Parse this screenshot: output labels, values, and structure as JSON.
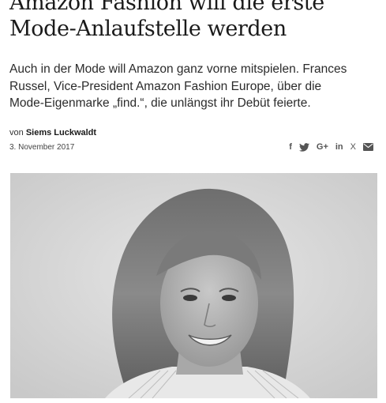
{
  "article": {
    "headline_line1": "Amazon Fashion will die erste",
    "headline_line2": "Mode-Anlaufstelle werden",
    "lead": "Auch in der Mode will Amazon ganz vorne mitspielen. Frances Russel, Vice-President Amazon Fashion Europe, über die Mode-Eigenmarke „find.“, die unlängst ihr Debüt feierte.",
    "byline_prefix": "von",
    "author": "Siems Luckwaldt",
    "date": "3. November 2017"
  },
  "share": {
    "icons": [
      {
        "name": "facebook-icon",
        "glyph": "f"
      },
      {
        "name": "twitter-icon",
        "glyph": ""
      },
      {
        "name": "googleplus-icon",
        "glyph": "G+"
      },
      {
        "name": "linkedin-icon",
        "glyph": "in"
      },
      {
        "name": "xing-icon",
        "glyph": "X"
      },
      {
        "name": "email-icon",
        "glyph": ""
      }
    ],
    "icon_color": "#555555"
  },
  "photo": {
    "description_style": "black-and-white portrait"
  }
}
